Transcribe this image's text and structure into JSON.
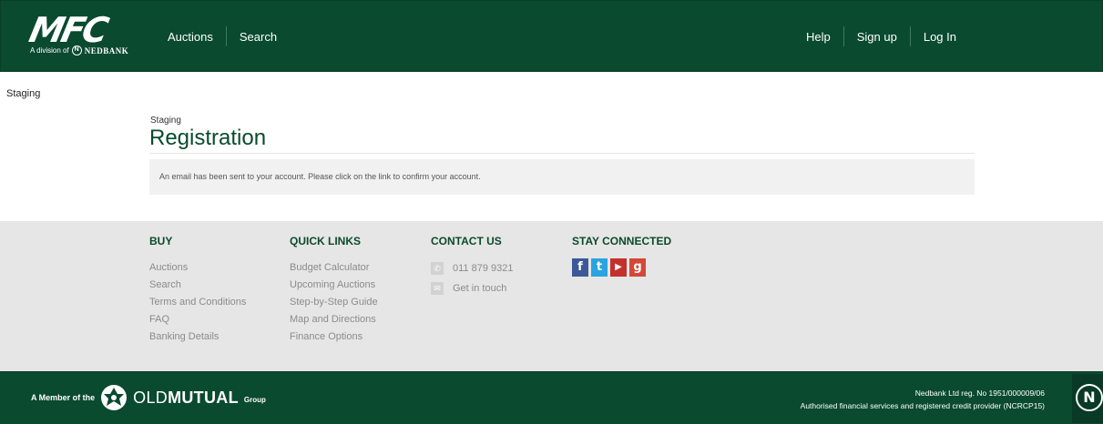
{
  "header": {
    "logo_text": "MFC",
    "logo_subtitle": "A division of",
    "logo_bank": "NEDBANK",
    "nav_left": [
      "Auctions",
      "Search"
    ],
    "nav_right": [
      "Help",
      "Sign up",
      "Log In"
    ]
  },
  "main": {
    "staging_corner": "Staging",
    "breadcrumb": "Staging",
    "title": "Registration",
    "notice": "An email has been sent to your account. Please click on the link to confirm your account."
  },
  "footer": {
    "buy": {
      "heading": "BUY",
      "links": [
        "Auctions",
        "Search",
        "Terms and Conditions",
        "FAQ",
        "Banking Details"
      ]
    },
    "quick_links": {
      "heading": "QUICK LINKS",
      "links": [
        "Budget Calculator",
        "Upcoming Auctions",
        "Step-by-Step Guide",
        "Map and Directions",
        "Finance Options"
      ]
    },
    "contact": {
      "heading": "CONTACT US",
      "phone": "011 879 9321",
      "get_in_touch": "Get in touch"
    },
    "stay_connected": {
      "heading": "STAY CONNECTED",
      "icons": [
        "facebook-icon",
        "twitter-icon",
        "youtube-icon",
        "google-plus-icon"
      ]
    }
  },
  "bottom": {
    "member_of": "A Member of the",
    "om_old": "OLD",
    "om_mutual": "MUTUAL",
    "om_group": "Group",
    "legal_line1": "Nedbank Ltd reg. No 1951/000009/06",
    "legal_line2": "Authorised financial services and registered credit provider (NCRCP15)"
  },
  "colors": {
    "brand_green": "#0a4a2f",
    "footer_bg": "#e6e6e6",
    "facebook": "#3b5998",
    "twitter": "#2aa3e0",
    "youtube": "#c4302b",
    "google_plus": "#d34836"
  }
}
